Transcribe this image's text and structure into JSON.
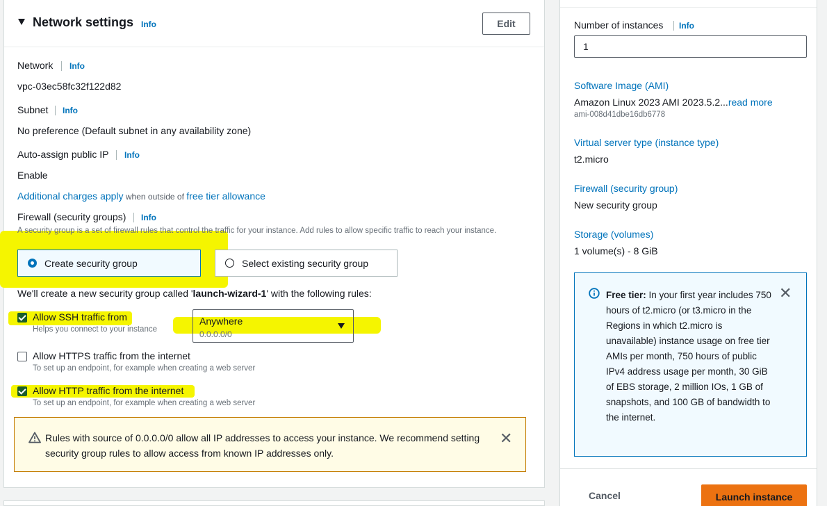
{
  "network_settings": {
    "title": "Network settings",
    "info": "Info",
    "edit_label": "Edit",
    "network": {
      "label": "Network",
      "info": "Info",
      "value": "vpc-03ec58fc32f122d82"
    },
    "subnet": {
      "label": "Subnet",
      "info": "Info",
      "value": "No preference (Default subnet in any availability zone)"
    },
    "auto_ip": {
      "label": "Auto-assign public IP",
      "info": "Info",
      "value": "Enable"
    },
    "charges": {
      "link1": "Additional charges apply",
      "middle": " when outside of ",
      "link2": "free tier allowance"
    },
    "firewall": {
      "label": "Firewall (security groups)",
      "info": "Info",
      "description": "A security group is a set of firewall rules that control the traffic for your instance. Add rules to allow specific traffic to reach your instance.",
      "option_create": "Create security group",
      "option_existing": "Select existing security group",
      "selected": "Create security group",
      "create_text_pre": "We'll create a new security group called '",
      "create_name": "launch-wizard-1",
      "create_text_post": "' with the following rules:"
    },
    "rules": {
      "ssh": {
        "label": "Allow SSH traffic from",
        "help": "Helps you connect to your instance",
        "checked": true,
        "source": "Anywhere",
        "source_cidr": "0.0.0.0/0"
      },
      "https": {
        "label": "Allow HTTPS traffic from the internet",
        "help": "To set up an endpoint, for example when creating a web server",
        "checked": false
      },
      "http": {
        "label": "Allow HTTP traffic from the internet",
        "help": "To set up an endpoint, for example when creating a web server",
        "checked": true
      }
    },
    "warning": {
      "line1": "Rules with source of 0.0.0.0/0 allow all IP addresses to access your instance. We recommend setting",
      "line2": "security group rules to allow access from known IP addresses only."
    }
  },
  "summary": {
    "instances_label": "Number of instances",
    "instances_info": "Info",
    "instances_value": "1",
    "ami_title": "Software Image (AMI)",
    "ami_value": "Amazon Linux 2023 AMI 2023.5.2...",
    "ami_more": "read more",
    "ami_id": "ami-008d41dbe16db6778",
    "type_title": "Virtual server type (instance type)",
    "type_value": "t2.micro",
    "firewall_title": "Firewall (security group)",
    "firewall_value": "New security group",
    "storage_title": "Storage (volumes)",
    "storage_value": "1 volume(s) - 8 GiB",
    "free_tier": {
      "bold": "Free tier:",
      "text": " In your first year includes 750 hours of t2.micro (or t3.micro in the Regions in which t2.micro is unavailable) instance usage on free tier AMIs per month, 750 hours of public IPv4 address usage per month, 30 GiB of EBS storage, 2 million IOs, 1 GB of snapshots, and 100 GB of bandwidth to the internet."
    },
    "cancel_label": "Cancel",
    "launch_label": "Launch instance"
  },
  "colors": {
    "link": "#0073bb",
    "highlight": "#f5f500",
    "primary_button": "#ec7211",
    "checkbox": "#1b5e2a"
  },
  "icons": {
    "collapse": "caret-down-icon",
    "warning": "warning-icon",
    "info": "info-circle-icon",
    "dismiss": "close-icon",
    "dropdown": "dropdown-arrow-icon"
  }
}
